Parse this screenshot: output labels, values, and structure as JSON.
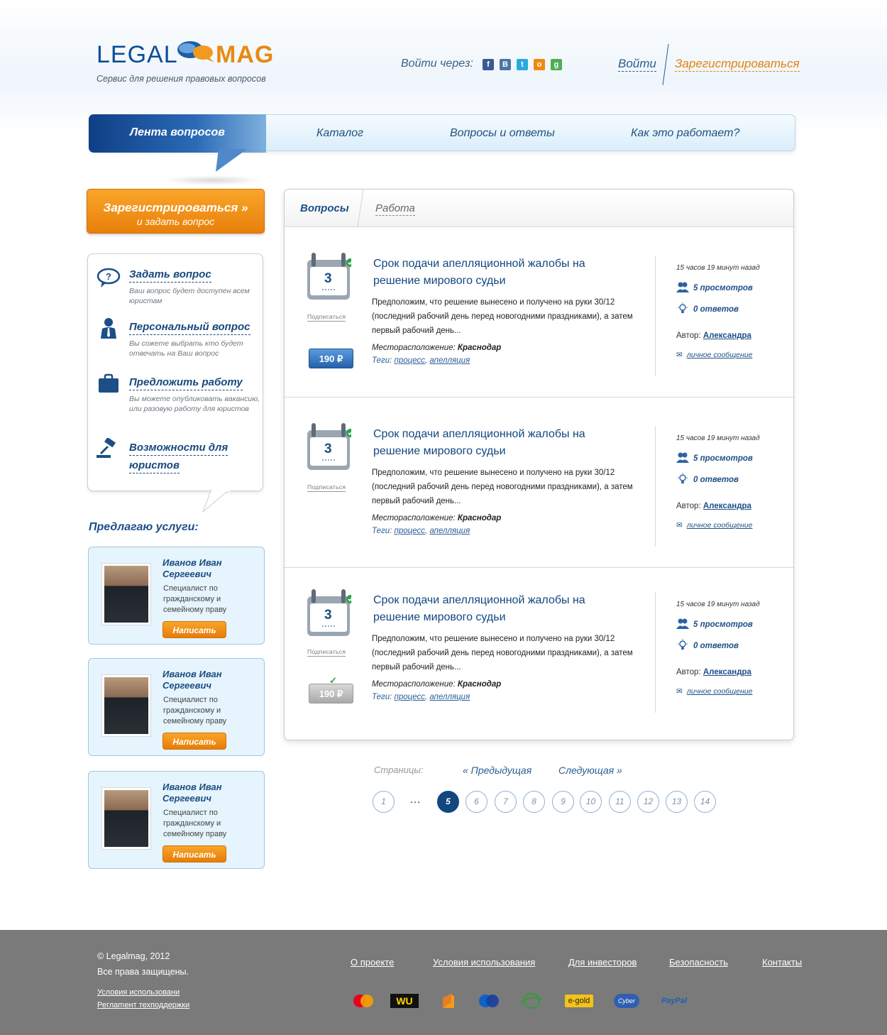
{
  "header": {
    "logo_left": "LEGAL",
    "logo_right": "MAG",
    "tagline": "Сервис для решения правовых вопросов",
    "login_via": "Войти через:",
    "socials": [
      {
        "name": "facebook-icon",
        "glyph": "f",
        "color": "#3b5998"
      },
      {
        "name": "vkontakte-icon",
        "glyph": "B",
        "color": "#4c75a3"
      },
      {
        "name": "twitter-icon",
        "glyph": "t",
        "color": "#2aa9e0"
      },
      {
        "name": "odnoklassniki-icon",
        "glyph": "o",
        "color": "#f08a0f"
      },
      {
        "name": "google-icon",
        "glyph": "g",
        "color": "#4caf50"
      }
    ],
    "login": "Войти",
    "register": "Зарегистрироваться"
  },
  "nav": {
    "items": [
      "Лента вопросов",
      "Каталог",
      "Вопросы и ответы",
      "Как это работает?"
    ]
  },
  "sidebar": {
    "register_button": "Зарегистрироваться »",
    "register_button_sub": "и задать вопрос",
    "items": [
      {
        "title": "Задать вопрос",
        "desc": "Ваш вопрос будет доступен всем юристам"
      },
      {
        "title": "Персональный вопрос",
        "desc": "Вы сожете выбрать кто будет отвечать на Ваш вопрос"
      },
      {
        "title": "Предложить работу",
        "desc": "Вы можете опубликовать вакансию, или разовую работу для юристов"
      },
      {
        "title": "Возможности для",
        "title2": "юристов",
        "desc": ""
      }
    ],
    "offer_title": "Предлагаю услуги:",
    "offers": [
      {
        "name": "Иванов Иван Сергеевич",
        "desc": "Специалист по гражданскому и семейному праву",
        "button": "Написать"
      },
      {
        "name": "Иванов Иван Сергеевич",
        "desc": "Специалист по гражданскому и семейному праву",
        "button": "Написать"
      },
      {
        "name": "Иванов Иван Сергеевич",
        "desc": "Специалист по гражданскому и семейному праву",
        "button": "Написать"
      }
    ]
  },
  "main": {
    "tabs": [
      "Вопросы",
      "Работа"
    ],
    "questions": [
      {
        "day": "3",
        "subscribe": "Подписаться",
        "price": "190 ₽",
        "paid": false,
        "title": "Срок подачи апелляционной жалобы на решение мирового судьи",
        "text": "Предположим, что решение вынесено и получено на руки 30/12 (последний рабочий день перед новогодними праздниками), а затем первый рабочий день...",
        "location_label": "Месторасположение:",
        "location": "Краснодар",
        "tags_label": "Теги:",
        "tag1": "процесс",
        "tag2": "апелляция",
        "time": "15 часов 19 минут назад",
        "views": "5 просмотров",
        "answers": "0 ответов",
        "author_label": "Автор:",
        "author": "Александра",
        "message": "личное сообщение"
      },
      {
        "day": "3",
        "subscribe": "Подписаться",
        "price": "",
        "paid": false,
        "title": "Срок подачи апелляционной жалобы на решение мирового судьи",
        "text": "Предположим, что решение вынесено и получено на руки 30/12 (последний рабочий день перед новогодними праздниками), а затем первый рабочий день...",
        "location_label": "Месторасположение:",
        "location": "Краснодар",
        "tags_label": "Теги:",
        "tag1": "процесс",
        "tag2": "апелляция",
        "time": "15 часов 19 минут назад",
        "views": "5 просмотров",
        "answers": "0 ответов",
        "author_label": "Автор:",
        "author": "Александра",
        "message": "личное сообщение"
      },
      {
        "day": "3",
        "subscribe": "Подписаться",
        "price": "190 ₽",
        "paid": true,
        "title": "Срок подачи апелляционной жалобы на решение мирового судьи",
        "text": "Предположим, что решение вынесено и получено на руки 30/12 (последний рабочий день перед новогодними праздниками), а затем первый рабочий день...",
        "location_label": "Месторасположение:",
        "location": "Краснодар",
        "tags_label": "Теги:",
        "tag1": "процесс",
        "tag2": "апелляция",
        "time": "15 часов 19 минут назад",
        "views": "5 просмотров",
        "answers": "0 ответов",
        "author_label": "Автор:",
        "author": "Александра",
        "message": "личное сообщение"
      }
    ]
  },
  "pagination": {
    "label": "Страницы:",
    "prev": "«  Предыдущая",
    "next": "Следующая  »",
    "ellipsis": "…",
    "pages": [
      "1",
      "5",
      "6",
      "7",
      "8",
      "9",
      "10",
      "11",
      "12",
      "13",
      "14"
    ],
    "current": "5"
  },
  "footer": {
    "copyright": "© Legalmag, 2012",
    "rights": "Все права защищены.",
    "terms_small": "Условия использовани",
    "support_small": "Реглamент техподдержки",
    "links": [
      "О проекте",
      "Условия использования",
      "Для инвесторов",
      "Безопасность",
      "Контакты"
    ],
    "payments": [
      "mastercard-icon",
      "western-union-icon",
      "yandex-money-icon",
      "maestro-icon",
      "webmoney-icon",
      "e-gold-icon",
      "cyberplat-icon",
      "paypal-icon"
    ],
    "payment_labels": {
      "wu": "WU",
      "egold": "e-gold",
      "cyber": "Cyber",
      "paypal": "PayPal"
    }
  }
}
